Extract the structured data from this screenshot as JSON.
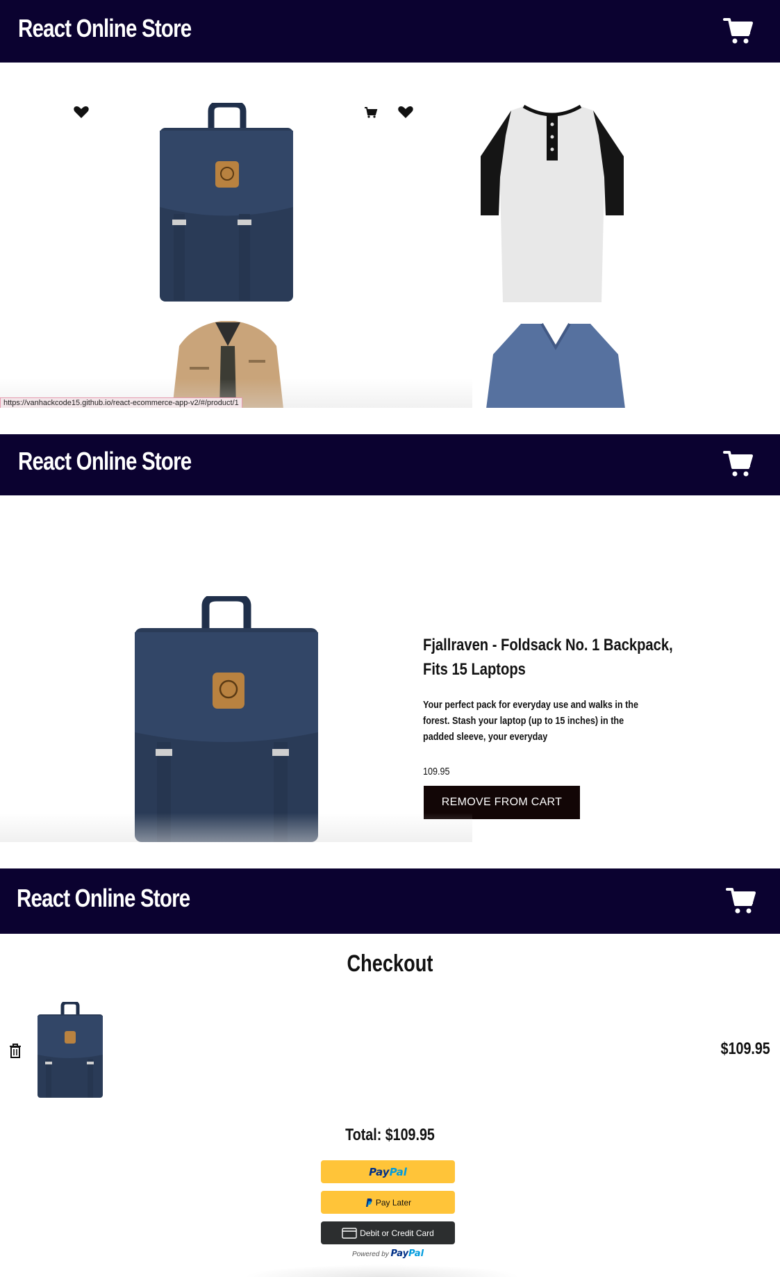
{
  "app": {
    "title": "React Online Store"
  },
  "colors": {
    "header_bg": "#0b0230",
    "button_dark": "#120606",
    "paypal_gold": "#ffc439",
    "paypal_dark": "#2c2e2f"
  },
  "icons": {
    "cart": "shopping-cart-icon",
    "heart": "heart-icon",
    "small_cart": "add-to-cart-icon",
    "trash": "trash-icon",
    "card": "credit-card-icon"
  },
  "product_list": {
    "status_url": "https://vanhackcode15.github.io/react-ecommerce-app-v2/#/product/1"
  },
  "product_detail": {
    "name": "Fjallraven - Foldsack No. 1 Backpack, Fits 15 Laptops",
    "description": "Your perfect pack for everyday use and walks in the forest. Stash your laptop (up to 15 inches) in the padded sleeve, your everyday",
    "price": "109.95",
    "remove_label": "REMOVE FROM CART"
  },
  "checkout": {
    "title": "Checkout",
    "item_price": "$109.95",
    "total": "Total: $109.95",
    "paypal": {
      "logo_part1": "Pay",
      "logo_part2": "Pal",
      "pay_later_label": "Pay Later",
      "card_label": "Debit or Credit Card",
      "powered_by": "Powered by"
    }
  }
}
